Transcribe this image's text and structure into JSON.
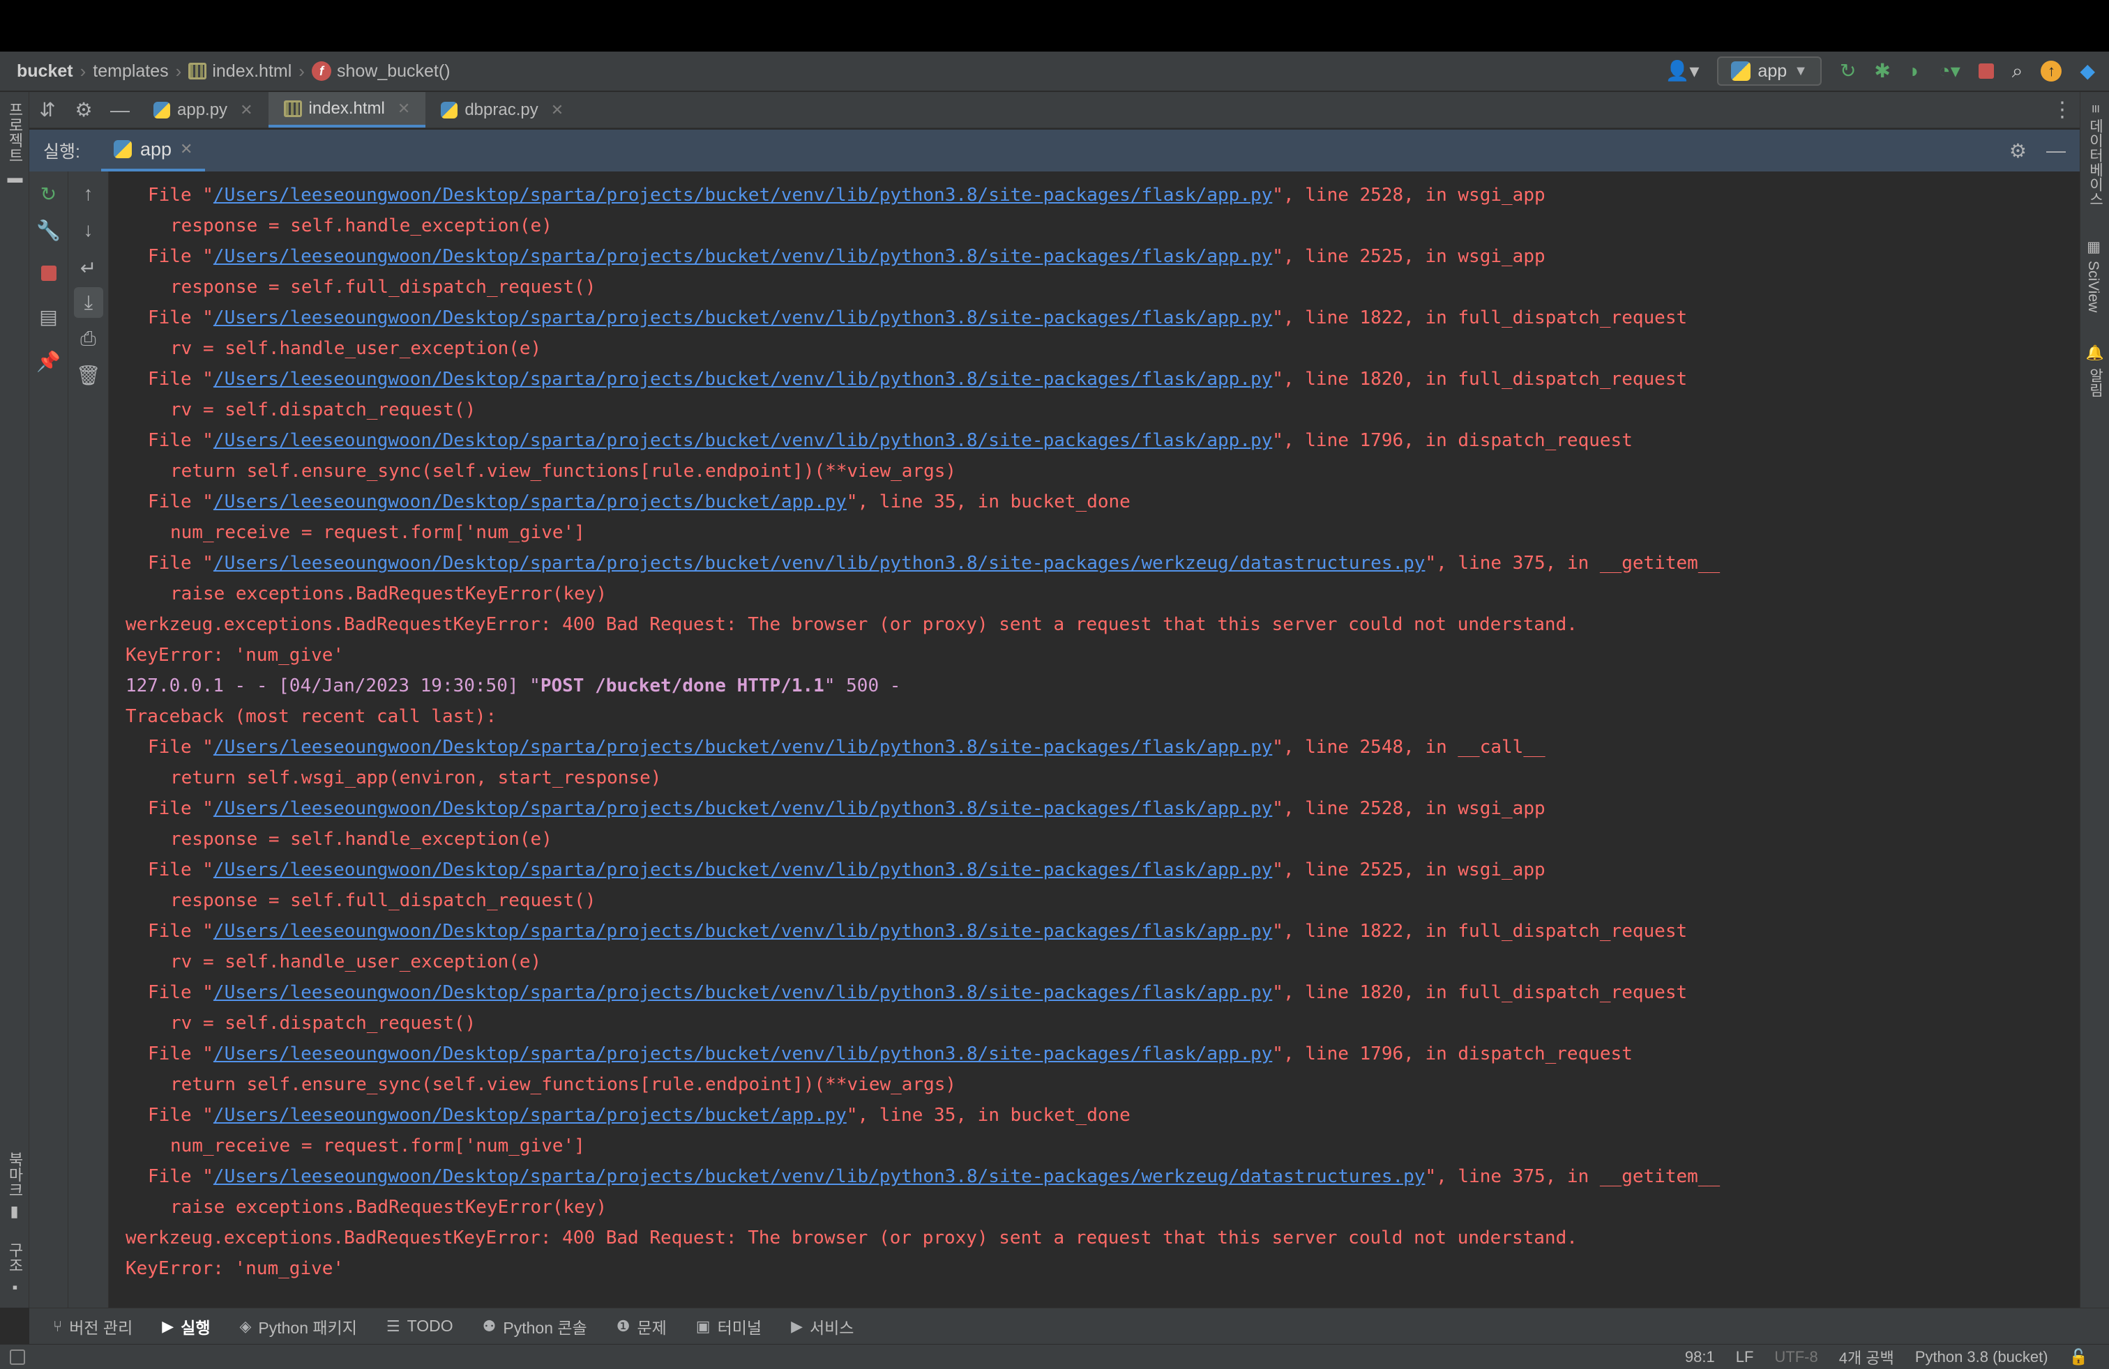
{
  "breadcrumb": [
    {
      "label": "bucket",
      "kind": "project"
    },
    {
      "label": "templates",
      "kind": "folder"
    },
    {
      "label": "index.html",
      "kind": "html-file"
    },
    {
      "label": "show_bucket()",
      "kind": "function"
    }
  ],
  "run_config": {
    "label": "app"
  },
  "editor_tabs": [
    {
      "label": "app.py",
      "active": false
    },
    {
      "label": "index.html",
      "active": true
    },
    {
      "label": "dbprac.py",
      "active": false
    }
  ],
  "left_stripe": {
    "top_label": "프로젝트",
    "bookmarks_label": "북마크",
    "structure_label": "구조"
  },
  "right_stripe": {
    "database_label": "데이터베이스",
    "sciview_label": "SciView",
    "notifications_label": "알림"
  },
  "run_panel": {
    "label": "실행:",
    "tab": "app"
  },
  "console_lines": [
    {
      "indent": 1,
      "pre": "File \"",
      "link": "/Users/leeseoungwoon/Desktop/sparta/projects/bucket/venv/lib/python3.8/site-packages/flask/app.py",
      "post": "\", line 2528, in wsgi_app"
    },
    {
      "indent": 2,
      "text": "response = self.handle_exception(e)"
    },
    {
      "indent": 1,
      "pre": "File \"",
      "link": "/Users/leeseoungwoon/Desktop/sparta/projects/bucket/venv/lib/python3.8/site-packages/flask/app.py",
      "post": "\", line 2525, in wsgi_app"
    },
    {
      "indent": 2,
      "text": "response = self.full_dispatch_request()"
    },
    {
      "indent": 1,
      "pre": "File \"",
      "link": "/Users/leeseoungwoon/Desktop/sparta/projects/bucket/venv/lib/python3.8/site-packages/flask/app.py",
      "post": "\", line 1822, in full_dispatch_request"
    },
    {
      "indent": 2,
      "text": "rv = self.handle_user_exception(e)"
    },
    {
      "indent": 1,
      "pre": "File \"",
      "link": "/Users/leeseoungwoon/Desktop/sparta/projects/bucket/venv/lib/python3.8/site-packages/flask/app.py",
      "post": "\", line 1820, in full_dispatch_request"
    },
    {
      "indent": 2,
      "text": "rv = self.dispatch_request()"
    },
    {
      "indent": 1,
      "pre": "File \"",
      "link": "/Users/leeseoungwoon/Desktop/sparta/projects/bucket/venv/lib/python3.8/site-packages/flask/app.py",
      "post": "\", line 1796, in dispatch_request"
    },
    {
      "indent": 2,
      "text": "return self.ensure_sync(self.view_functions[rule.endpoint])(**view_args)"
    },
    {
      "indent": 1,
      "pre": "File \"",
      "link": "/Users/leeseoungwoon/Desktop/sparta/projects/bucket/app.py",
      "post": "\", line 35, in bucket_done"
    },
    {
      "indent": 2,
      "text": "num_receive = request.form['num_give']"
    },
    {
      "indent": 1,
      "pre": "File \"",
      "link": "/Users/leeseoungwoon/Desktop/sparta/projects/bucket/venv/lib/python3.8/site-packages/werkzeug/datastructures.py",
      "post": "\", line 375, in __getitem__"
    },
    {
      "indent": 2,
      "text": "raise exceptions.BadRequestKeyError(key)"
    },
    {
      "indent": 0,
      "text": "werkzeug.exceptions.BadRequestKeyError: 400 Bad Request: The browser (or proxy) sent a request that this server could not understand."
    },
    {
      "indent": 0,
      "text": "KeyError: 'num_give'"
    },
    {
      "indent": 0,
      "kind": "access",
      "pre": "127.0.0.1 - - [04/Jan/2023 19:30:50] \"",
      "bold": "POST /bucket/done HTTP/1.1",
      "post": "\" 500 -"
    },
    {
      "indent": 0,
      "text": "Traceback (most recent call last):"
    },
    {
      "indent": 1,
      "pre": "File \"",
      "link": "/Users/leeseoungwoon/Desktop/sparta/projects/bucket/venv/lib/python3.8/site-packages/flask/app.py",
      "post": "\", line 2548, in __call__"
    },
    {
      "indent": 2,
      "text": "return self.wsgi_app(environ, start_response)"
    },
    {
      "indent": 1,
      "pre": "File \"",
      "link": "/Users/leeseoungwoon/Desktop/sparta/projects/bucket/venv/lib/python3.8/site-packages/flask/app.py",
      "post": "\", line 2528, in wsgi_app"
    },
    {
      "indent": 2,
      "text": "response = self.handle_exception(e)"
    },
    {
      "indent": 1,
      "pre": "File \"",
      "link": "/Users/leeseoungwoon/Desktop/sparta/projects/bucket/venv/lib/python3.8/site-packages/flask/app.py",
      "post": "\", line 2525, in wsgi_app"
    },
    {
      "indent": 2,
      "text": "response = self.full_dispatch_request()"
    },
    {
      "indent": 1,
      "pre": "File \"",
      "link": "/Users/leeseoungwoon/Desktop/sparta/projects/bucket/venv/lib/python3.8/site-packages/flask/app.py",
      "post": "\", line 1822, in full_dispatch_request"
    },
    {
      "indent": 2,
      "text": "rv = self.handle_user_exception(e)"
    },
    {
      "indent": 1,
      "pre": "File \"",
      "link": "/Users/leeseoungwoon/Desktop/sparta/projects/bucket/venv/lib/python3.8/site-packages/flask/app.py",
      "post": "\", line 1820, in full_dispatch_request"
    },
    {
      "indent": 2,
      "text": "rv = self.dispatch_request()"
    },
    {
      "indent": 1,
      "pre": "File \"",
      "link": "/Users/leeseoungwoon/Desktop/sparta/projects/bucket/venv/lib/python3.8/site-packages/flask/app.py",
      "post": "\", line 1796, in dispatch_request"
    },
    {
      "indent": 2,
      "text": "return self.ensure_sync(self.view_functions[rule.endpoint])(**view_args)"
    },
    {
      "indent": 1,
      "pre": "File \"",
      "link": "/Users/leeseoungwoon/Desktop/sparta/projects/bucket/app.py",
      "post": "\", line 35, in bucket_done"
    },
    {
      "indent": 2,
      "text": "num_receive = request.form['num_give']"
    },
    {
      "indent": 1,
      "pre": "File \"",
      "link": "/Users/leeseoungwoon/Desktop/sparta/projects/bucket/venv/lib/python3.8/site-packages/werkzeug/datastructures.py",
      "post": "\", line 375, in __getitem__"
    },
    {
      "indent": 2,
      "text": "raise exceptions.BadRequestKeyError(key)"
    },
    {
      "indent": 0,
      "text": "werkzeug.exceptions.BadRequestKeyError: 400 Bad Request: The browser (or proxy) sent a request that this server could not understand."
    },
    {
      "indent": 0,
      "text": "KeyError: 'num_give'"
    }
  ],
  "bottom_tools": [
    {
      "label": "버전 관리",
      "icon": "branch-icon",
      "active": false
    },
    {
      "label": "실행",
      "icon": "play-icon",
      "active": true
    },
    {
      "label": "Python 패키지",
      "icon": "layers-icon",
      "active": false
    },
    {
      "label": "TODO",
      "icon": "list-icon",
      "active": false
    },
    {
      "label": "Python 콘솔",
      "icon": "python-icon",
      "active": false
    },
    {
      "label": "문제",
      "icon": "warning-icon",
      "active": false
    },
    {
      "label": "터미널",
      "icon": "terminal-icon",
      "active": false
    },
    {
      "label": "서비스",
      "icon": "services-icon",
      "active": false
    }
  ],
  "status": {
    "position": "98:1",
    "line_separator": "LF",
    "encoding": "UTF-8",
    "indent": "4개 공백",
    "interpreter": "Python 3.8 (bucket)"
  },
  "colors": {
    "error_text": "#ff6b68",
    "link": "#5394ec",
    "access_log": "#d7a0d6",
    "accent": "#4a88c7",
    "run_header_bg": "#3d4b5c"
  }
}
